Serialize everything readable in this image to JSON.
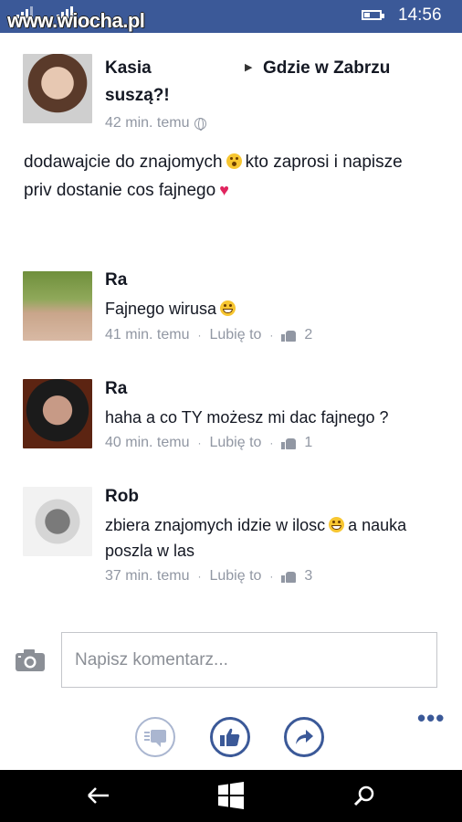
{
  "status_bar": {
    "watermark": "www.wiocha.pl",
    "sim1_label": "1",
    "sim2_label": "2",
    "time": "14:56"
  },
  "post": {
    "author": "Kasia",
    "group_line1": "Gdzie w Zabrzu",
    "group_line2": "suszą?!",
    "time": "42 min. temu",
    "text_part1": "dodawajcie do znajomych",
    "text_part2": "kto zaprosi i napisze priv dostanie cos fajnego"
  },
  "comments": [
    {
      "name": "Ra",
      "text": "Fajnego wirusa",
      "time": "41 min. temu",
      "like_label": "Lubię to",
      "like_count": "2"
    },
    {
      "name": "Ra",
      "text": "haha a co TY możesz mi dac fajnego ?",
      "time": "40 min. temu",
      "like_label": "Lubię to",
      "like_count": "1"
    },
    {
      "name": "Rob",
      "text_part1": "zbiera znajomych idzie w ilosc",
      "text_part2": "a nauka poszla w las",
      "time": "37 min. temu",
      "like_label": "Lubię to",
      "like_count": "3"
    }
  ],
  "comment_box": {
    "placeholder": "Napisz komentarz..."
  },
  "colors": {
    "brand": "#3b5998",
    "meta": "#9197a3",
    "heart": "#e0245e"
  },
  "icons": [
    "camera-icon",
    "comments-list-icon",
    "like-icon",
    "share-icon",
    "more-icon",
    "back-icon",
    "windows-icon",
    "search-icon"
  ]
}
